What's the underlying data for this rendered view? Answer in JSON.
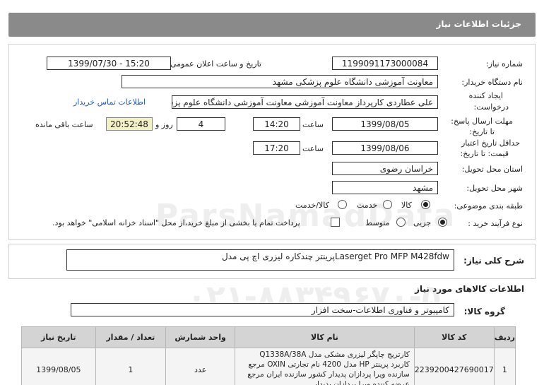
{
  "header": {
    "title": "جزئیات اطلاعات نیاز"
  },
  "form": {
    "need_number_label": "شماره نیاز:",
    "need_number": "1199091173000084",
    "announce_label": "تاریخ و ساعت اعلان عمومی:",
    "announce_value": "1399/07/30 - 15:20",
    "buyer_label": "نام دستگاه خریدار:",
    "buyer_value": "معاونت آموزشی دانشگاه علوم پزشکی مشهد",
    "creator_label_1": "ایجاد کننده",
    "creator_label_2": "درخواست:",
    "creator_value": "علی عطاردی کارپرداز معاونت آموزشی معاونت آموزشی دانشگاه علوم پزشکی م",
    "contact_link": "اطلاعات تماس خریدار",
    "deadline_label_1": "مهلت ارسال پاسخ:",
    "deadline_label_2": "تا تاریخ:",
    "deadline_date": "1399/08/05",
    "time_label": "ساعت",
    "deadline_time": "14:20",
    "days_value": "4",
    "days_label": "روز و",
    "remaining_time": "20:52:48",
    "remaining_label": "ساعت باقی مانده",
    "validity_label_1": "حداقل تاریخ اعتبار",
    "validity_label_2": "قیمت: تا تاریخ:",
    "validity_date": "1399/08/06",
    "validity_time_label": "ساعت",
    "validity_time": "17:20",
    "province_label": "استان محل تحویل:",
    "province_value": "خراسان رضوی",
    "city_label": "شهر محل تحویل:",
    "city_value": "مشهد",
    "category_label": "طبقه بندی موضوعی:",
    "category_options": [
      "کالا",
      "خدمت",
      "کالا/خدمت"
    ],
    "process_label": "نوع فرآیند خرید :",
    "process_options": [
      "جزیی",
      "متوسط"
    ],
    "payment_note": "پرداخت تمام یا بخشی از مبلغ خرید،از محل \"اسناد خزانه اسلامی\" خواهد بود."
  },
  "summary": {
    "label": "شرح کلی نیاز:",
    "value": "پرینتر چندکاره لیزری اچ پی مدلLaserget Pro MFP M428fdw"
  },
  "goods": {
    "section_title": "اطلاعات کالاهای مورد نیاز",
    "group_label": "گروه کالا:",
    "group_value": "کامپیوتر و فناوری اطلاعات-سخت افزار",
    "columns": [
      "ردیف",
      "کد کالا",
      "نام کالا",
      "واحد شمارش",
      "تعداد / مقدار",
      "تاریخ نیاز"
    ],
    "rows": [
      {
        "row": "1",
        "code": "2239200427690017",
        "name": "کارتریج چاپگر لیزری مشکی مدل Q1338A/38A کاربرد پرینتر HP مدل 4200 نام تجارتی OXIN مرجع سازنده ویرا پردازان پدیدار کشور سازنده ایران مرجع عرضه کننده ویرا پردازان پدیدار",
        "unit": "عدد",
        "qty": "1",
        "date": "1399/08/05"
      }
    ]
  },
  "watermark": {
    "text": "ParsNamadData",
    "phone": "۰۲۱-۸۸۳۴۹۶۷۰-۵"
  }
}
